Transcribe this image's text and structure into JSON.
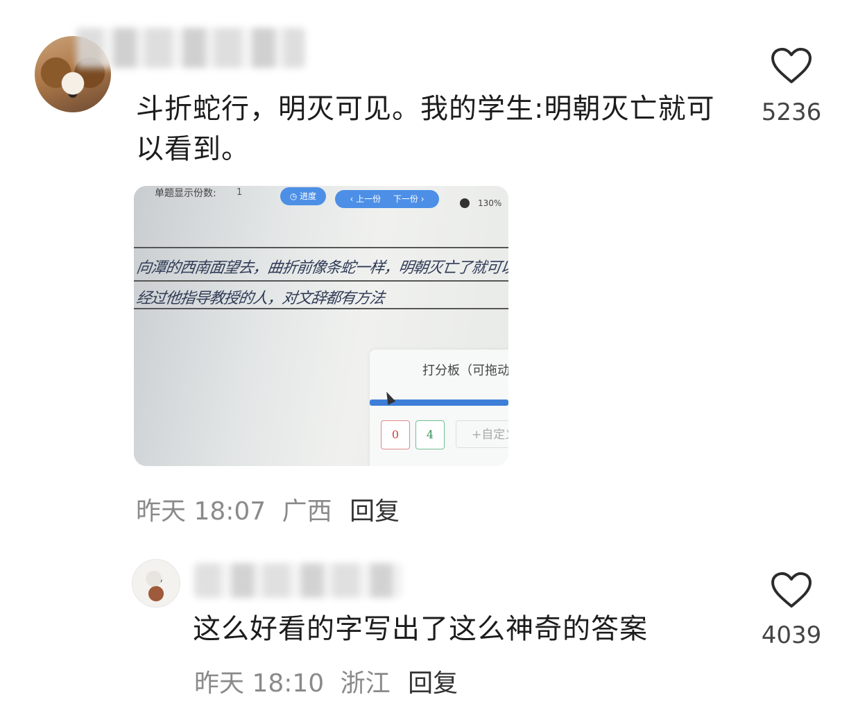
{
  "comments": [
    {
      "text": "斗折蛇行，明灭可见。我的学生:明朝灭亡就可以看到。",
      "likes": "5236",
      "time": "昨天 18:07",
      "location": "广西",
      "reply_label": "回复",
      "photo": {
        "toolbar_label": "单题显示份数:",
        "select_value": "1",
        "progress_button": "◷ 进度",
        "prev_button": "‹ 上一份",
        "next_button": "下一份 ›",
        "zoom": "130%",
        "handwriting_line1": "向潭的西南面望去，曲折前像条蛇一样，明朝灭亡了就可以见到",
        "handwriting_line2": "经过他指导教授的人，对文辞都有方法",
        "score_panel_title": "打分板（可拖动",
        "score_options": [
          "0",
          "4"
        ],
        "custom_label": "+自定义"
      }
    },
    {
      "text": "这么好看的字写出了这么神奇的答案",
      "likes": "4039",
      "time": "昨天 18:10",
      "location": "浙江",
      "reply_label": "回复"
    }
  ],
  "icons": {
    "like": "heart-outline-icon"
  }
}
